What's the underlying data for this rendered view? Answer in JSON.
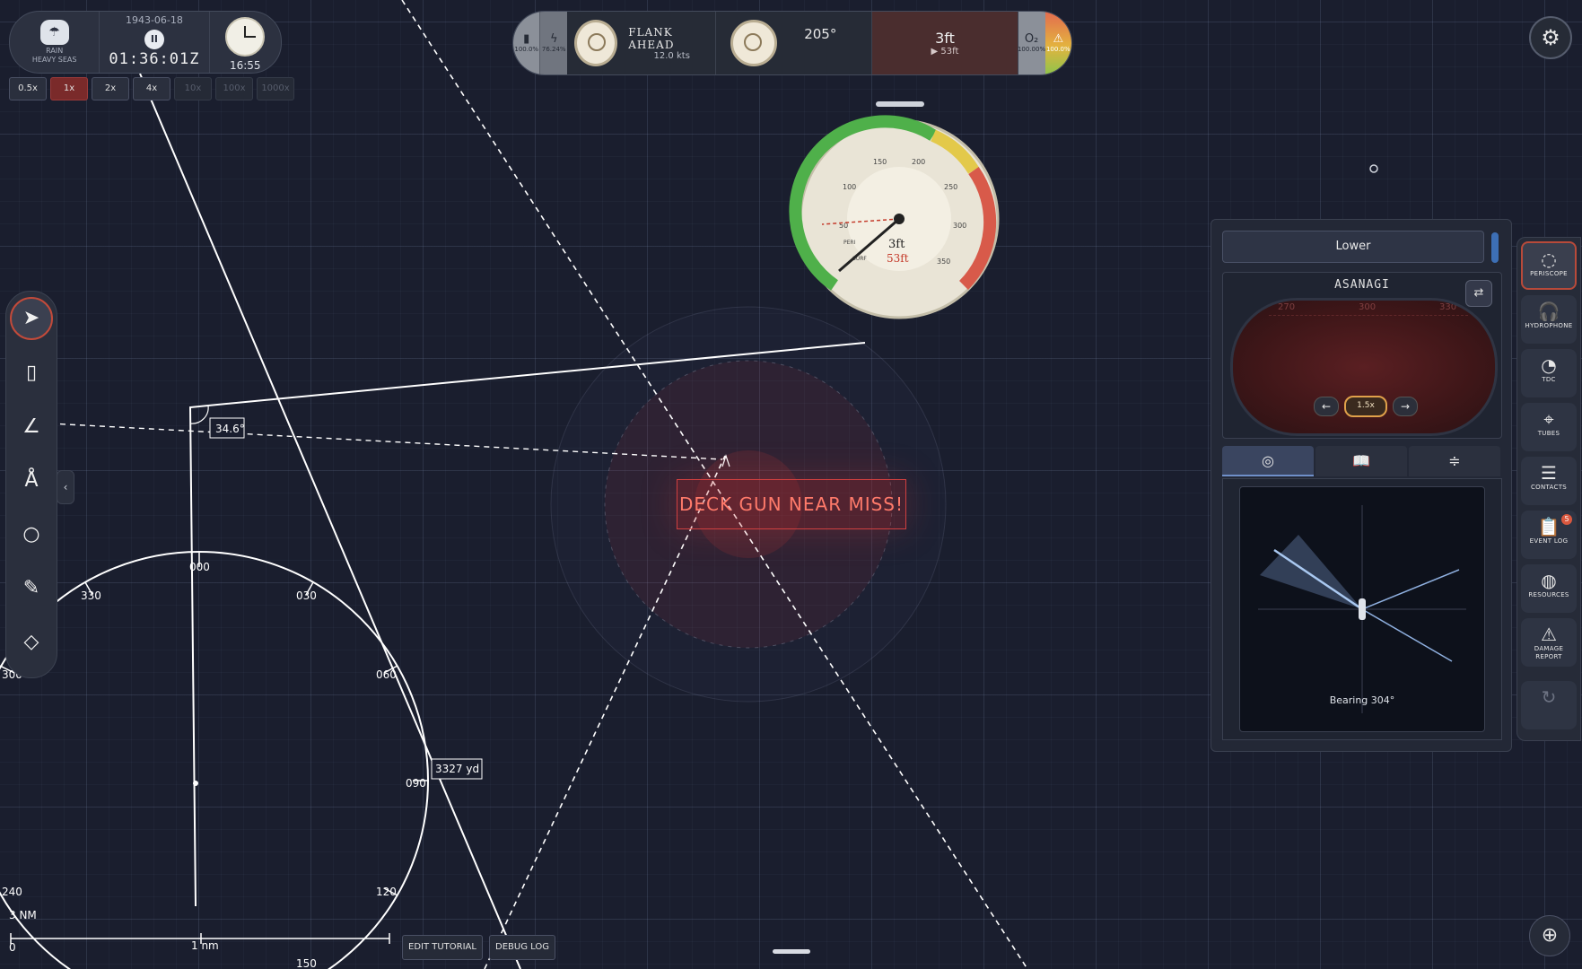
{
  "clock_panel": {
    "weather_line1": "RAIN",
    "weather_line2": "HEAVY SEAS",
    "date": "1943-06-18",
    "game_time": "01:36:01Z",
    "local_time": "16:55",
    "pause_icon": "II"
  },
  "time_speeds": [
    "0.5x",
    "1x",
    "2x",
    "4x",
    "10x",
    "100x",
    "1000x"
  ],
  "status": {
    "battery_pct": "100.0%",
    "power_pct": "76.24%",
    "telegraph_order": "FLANK AHEAD",
    "speed": "12.0 kts",
    "heading": "205°",
    "depth": "3ft",
    "target_depth": "▶ 53ft",
    "o2_pct": "100.00%",
    "hull_pct": "100.0%"
  },
  "depth_gauge": {
    "current": "3ft",
    "ordered": "53ft",
    "ticks": [
      "50",
      "100",
      "150",
      "200",
      "250",
      "300",
      "350"
    ],
    "peri_label": "PERI",
    "surf_label": "SURF"
  },
  "alert": {
    "text": "DECK GUN NEAR MISS!"
  },
  "map": {
    "angle_label": "34.6°",
    "range_label": "3327 yd",
    "compass_labels": [
      "000",
      "030",
      "060",
      "090",
      "120",
      "150",
      "240",
      "300",
      "330"
    ],
    "scale_label": "3 NM",
    "scale_mark": "1 nm",
    "scale_zero": "0"
  },
  "right_panel": {
    "depth_button": "Lower",
    "scope_title": "ASANAGI",
    "scope_ticks": [
      "270",
      "300",
      "330"
    ],
    "zoom": "1.5x",
    "bearing": "Bearing 304°"
  },
  "stations": [
    {
      "label": "PERISCOPE",
      "icon": "periscope-icon"
    },
    {
      "label": "HYDROPHONE",
      "icon": "headphones-icon"
    },
    {
      "label": "TDC",
      "icon": "tdc-gauge-icon"
    },
    {
      "label": "TUBES",
      "icon": "crosshair-icon"
    },
    {
      "label": "CONTACTS",
      "icon": "list-icon"
    },
    {
      "label": "EVENT LOG",
      "icon": "clipboard-icon",
      "badge": "5"
    },
    {
      "label": "RESOURCES",
      "icon": "resources-icon"
    },
    {
      "label": "DAMAGE REPORT",
      "icon": "warning-icon"
    },
    {
      "label": "",
      "icon": "navigation-icon"
    }
  ],
  "bottom_buttons": {
    "edit_tutorial": "EDIT TUTORIAL",
    "debug_log": "DEBUG LOG"
  },
  "colors": {
    "accent_red": "#c24a3a",
    "alert": "#ff7a6a",
    "panel": "#232836",
    "map_bg": "#1a1e2e"
  }
}
